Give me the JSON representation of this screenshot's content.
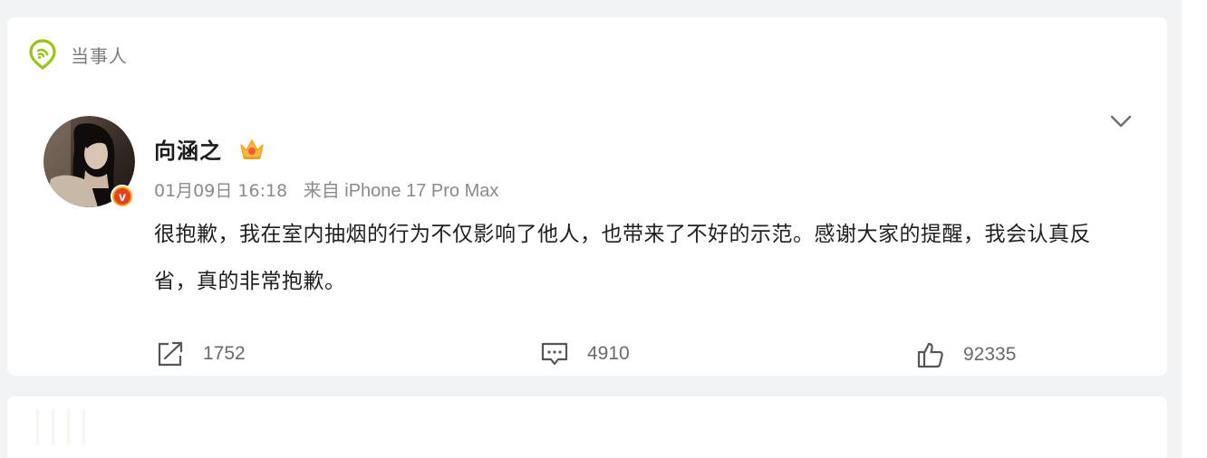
{
  "topic": {
    "label": "当事人",
    "icon": "location-pin-icon",
    "color": "#9ac21a"
  },
  "post": {
    "author": "向涵之",
    "badge_icon": "crown-icon",
    "verified_icon": "verified-v-icon",
    "verified_letter": "v",
    "time": "01月09日 16:18",
    "source": "来自 iPhone 17 Pro Max",
    "text": "很抱歉，我在室内抽烟的行为不仅影响了他人，也带来了不好的示范。感谢大家的提醒，我会认真反省，真的非常抱歉。",
    "menu_icon": "chevron-down-icon"
  },
  "actions": {
    "repost": {
      "icon": "repost-icon",
      "count": "1752"
    },
    "comment": {
      "icon": "comment-icon",
      "count": "4910"
    },
    "like": {
      "icon": "thumbs-up-icon",
      "count": "92335"
    }
  },
  "colors": {
    "background": "#f2f3f5",
    "card": "#ffffff",
    "text": "#1f1f1f",
    "meta": "#8a8a8a",
    "accent": "#9ac21a",
    "verified": "#e2431d"
  }
}
